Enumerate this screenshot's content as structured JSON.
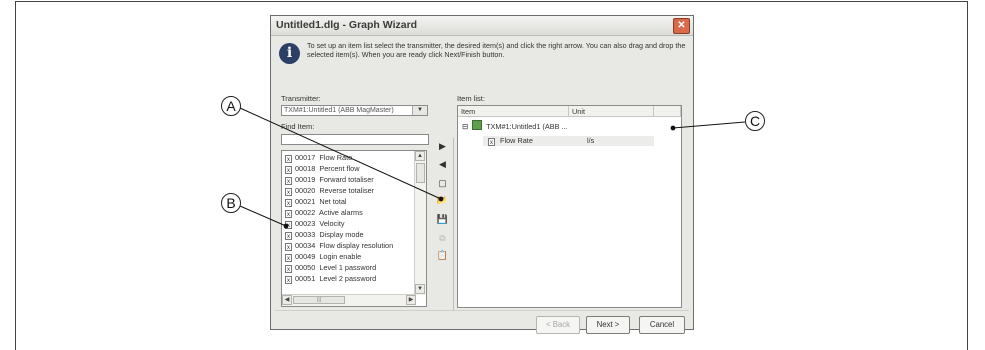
{
  "dialog": {
    "title": "Untitled1.dlg - Graph Wizard",
    "close_glyph": "✕",
    "intro": "To set up an item list select the transmitter, the desired item(s) and click the right arrow. You can also drag and drop the selected item(s). When you are ready click Next/Finish button."
  },
  "transmitter": {
    "label": "Transmitter:",
    "value": "TXM#1:Untitled1 (ABB MagMaster)",
    "dropdown_glyph": "▼"
  },
  "find": {
    "label": "Find Item:",
    "value": ""
  },
  "available_items": [
    {
      "code": "00017",
      "name": "Flow Rate"
    },
    {
      "code": "00018",
      "name": "Percent flow"
    },
    {
      "code": "00019",
      "name": "Forward totaliser"
    },
    {
      "code": "00020",
      "name": "Reverse totaliser"
    },
    {
      "code": "00021",
      "name": "Net total"
    },
    {
      "code": "00022",
      "name": "Active alarms"
    },
    {
      "code": "00023",
      "name": "Velocity"
    },
    {
      "code": "00033",
      "name": "Display mode"
    },
    {
      "code": "00034",
      "name": "Flow display resolution"
    },
    {
      "code": "00049",
      "name": "Login enable"
    },
    {
      "code": "00050",
      "name": "Level 1 password"
    },
    {
      "code": "00051",
      "name": "Level 2 password"
    }
  ],
  "item_list": {
    "label": "Item list:",
    "columns": [
      "Item",
      "Unit"
    ],
    "root": {
      "expander": "⊟",
      "label": "TXM#1:Untitled1 (ABB ..."
    },
    "child": {
      "name": "Flow Rate",
      "unit": "l/s"
    }
  },
  "toolbar": {
    "add": "▶",
    "remove": "◀",
    "new": "▢",
    "open": "📂",
    "save": "💾",
    "copy": "⧉",
    "paste": "📋"
  },
  "buttons": {
    "back": "< Back",
    "next": "Next >",
    "cancel": "Cancel"
  },
  "callouts": {
    "a": "A",
    "b": "B",
    "c": "C"
  },
  "icons": {
    "info": "i",
    "doc": "x"
  },
  "scroll": {
    "up": "▲",
    "down": "▼",
    "left": "◀",
    "right": "▶",
    "grip": "|||"
  }
}
